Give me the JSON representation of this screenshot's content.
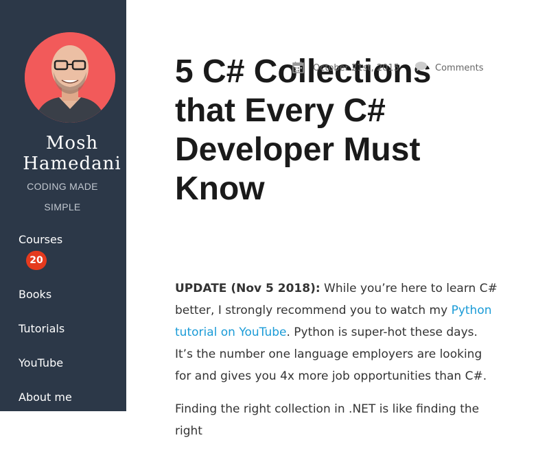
{
  "sidebar": {
    "site_name_line1": "Mosh",
    "site_name_line2": "Hamedani",
    "tagline_line1": "CODING MADE",
    "tagline_line2": "SIMPLE",
    "nav": [
      {
        "label": "Courses",
        "badge": "20"
      },
      {
        "label": "Books"
      },
      {
        "label": "Tutorials"
      },
      {
        "label": "YouTube"
      },
      {
        "label": "About me"
      }
    ]
  },
  "post": {
    "title": "5 C# Collections that Every C# Developer Must Know",
    "date": "October 21st, 2015",
    "comments_label": "Comments",
    "update_label": "UPDATE (Nov 5 2018):",
    "update_text_1": " While you’re here to learn C# better, I strongly recommend you to watch my ",
    "update_link": "Python tutorial on YouTube",
    "update_text_2": ". Python is super-hot these days. It’s the number one language employers are looking for and gives you 4x more job opportunities than C#.",
    "next_paragraph": "Finding the right collection in .NET is like finding the right"
  },
  "colors": {
    "sidebar_bg": "#2c3848",
    "badge": "#e53a1e",
    "link": "#1a9bd7"
  }
}
